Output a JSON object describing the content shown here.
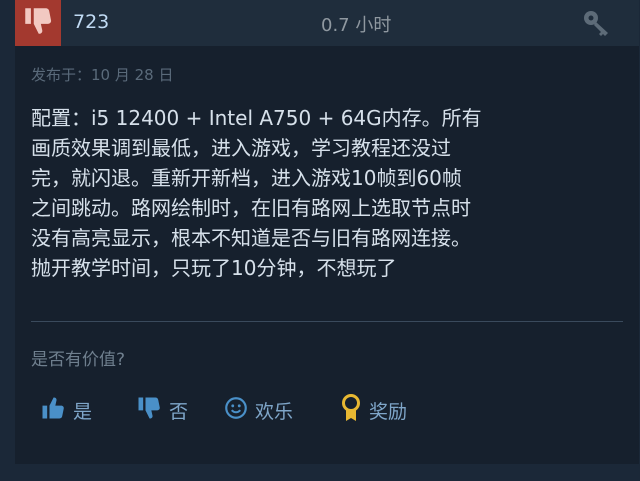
{
  "review_header": {
    "recommendation_icon": "thumbs-down-icon",
    "products_count": "723",
    "hours_played": "0.7 小时",
    "key_icon": "key-icon",
    "accent_color": "#a3392f"
  },
  "review": {
    "posted_date": "发布于：10 月 28 日",
    "text": "配置：i5 12400 + Intel A750 + 64G内存。所有\n画质效果调到最低，进入游戏，学习教程还没过\n完，就闪退。重新开新档，进入游戏10帧到60帧\n之间跳动。路网绘制时，在旧有路网上选取节点时\n没有高亮显示，根本不知道是否与旧有路网连接。\n抛开教学时间，只玩了10分钟，不想玩了"
  },
  "feedback": {
    "question": "是否有价值?",
    "buttons": [
      {
        "icon": "thumbs-up-icon",
        "label": "是"
      },
      {
        "icon": "thumbs-down-icon",
        "label": "否"
      },
      {
        "icon": "smiley-icon",
        "label": "欢乐"
      },
      {
        "icon": "award-icon",
        "label": "奖励"
      }
    ]
  }
}
